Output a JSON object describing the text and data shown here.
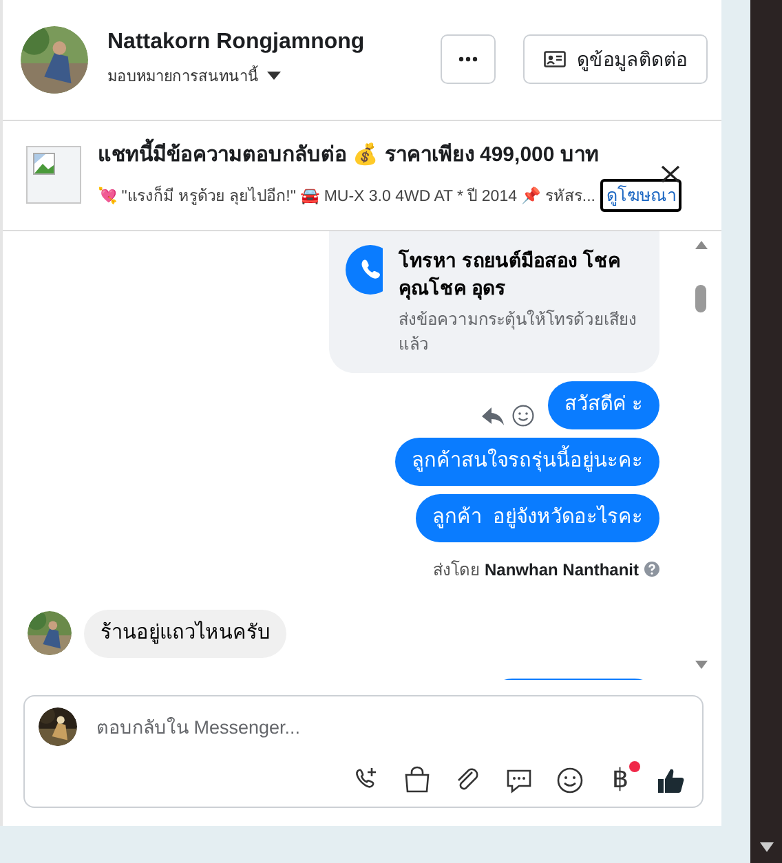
{
  "header": {
    "name": "Nattakorn Rongjamnong",
    "assign_label": "มอบหมายการสนทนานี้",
    "contact_button": "ดูข้อมูลติดต่อ"
  },
  "ad": {
    "title": "แชทนี้มีข้อความตอบกลับต่อ 💰 ราคาเพียง 499,000 บาท",
    "subtitle": "💘 \"แรงก็มี หรูด้วย ลุยไปอีก!\" 🚘 MU-X 3.0 4WD AT * ปี 2014 📌 รหัสร...",
    "link": "ดูโฆษณา"
  },
  "messages": [
    {
      "kind": "call_card",
      "title": "โทรหา รถยนต์มือสอง โชคคุณโชค อุดร",
      "subtitle": "ส่งข้อความกระตุ้นให้โทรด้วยเสียงแล้ว"
    },
    {
      "kind": "outgoing",
      "text": "สวัสดีค่ ะ",
      "show_actions": true
    },
    {
      "kind": "outgoing",
      "text": "ลูกค้าสนใจรถรุ่นนี้อยู่นะคะ",
      "show_actions": false
    },
    {
      "kind": "outgoing",
      "text": "ลูกค้า  อยู่จังหวัดอะไรคะ",
      "show_actions": false
    },
    {
      "kind": "sent_by",
      "text": "ส่งโดย **Nanwhan Nanthanit**"
    },
    {
      "kind": "incoming",
      "text": "ร้านอยู่แถวไหนครับ"
    },
    {
      "kind": "outgoing_cut"
    }
  ],
  "composer": {
    "placeholder": "ตอบกลับใน Messenger...",
    "baht_symbol": "฿",
    "baht_dot": true
  }
}
